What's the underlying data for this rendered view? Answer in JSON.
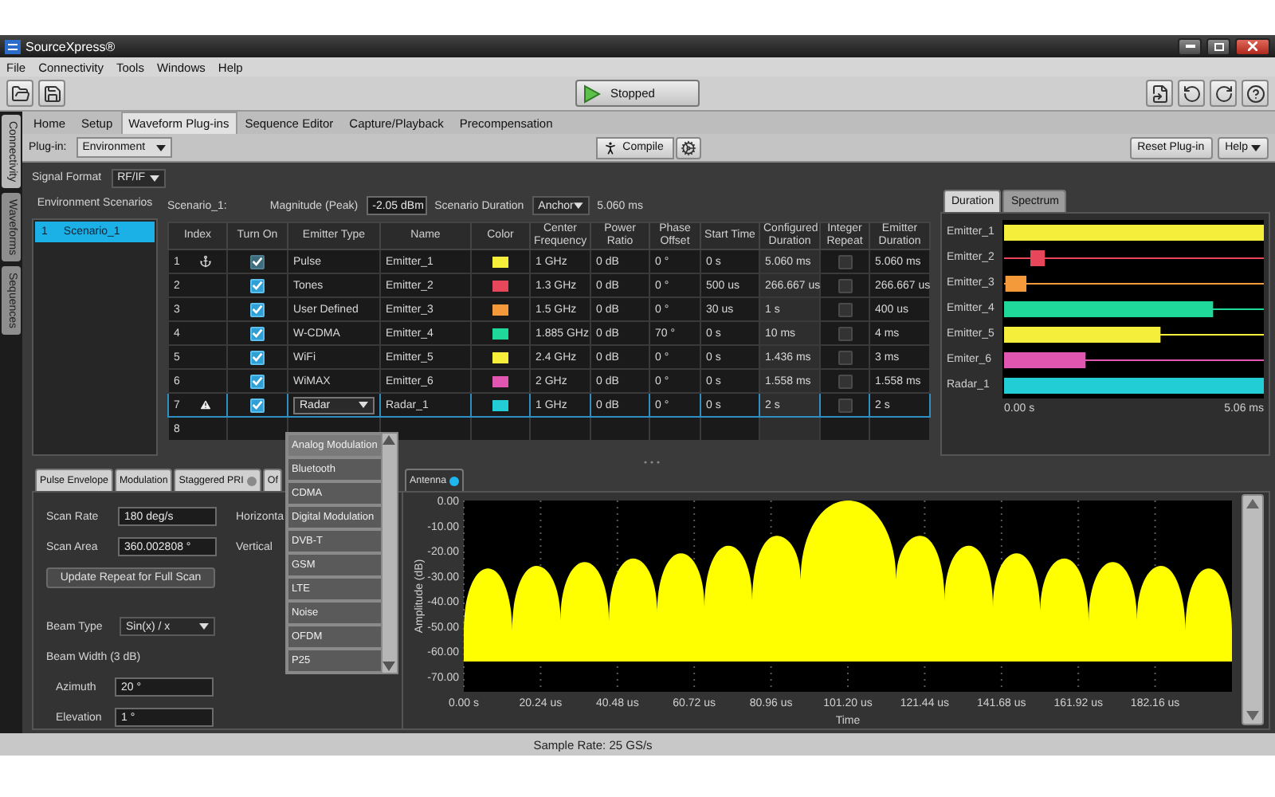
{
  "window": {
    "title": "SourceXpress®"
  },
  "menu": [
    "File",
    "Connectivity",
    "Tools",
    "Windows",
    "Help"
  ],
  "toolbar": {
    "run_button": "Stopped"
  },
  "side_tabs": [
    {
      "label": "Connectivity",
      "selected": true
    },
    {
      "label": "Waveforms",
      "selected": false
    },
    {
      "label": "Sequences",
      "selected": false
    }
  ],
  "tabs": [
    {
      "label": "Home",
      "selected": false
    },
    {
      "label": "Setup",
      "selected": false
    },
    {
      "label": "Waveform Plug-ins",
      "selected": true
    },
    {
      "label": "Sequence Editor",
      "selected": false
    },
    {
      "label": "Capture/Playback",
      "selected": false
    },
    {
      "label": "Precompensation",
      "selected": false
    }
  ],
  "plugin_bar": {
    "label": "Plug-in:",
    "plugin": "Environment",
    "compile": "Compile",
    "reset": "Reset Plug-in",
    "help": "Help"
  },
  "signal_format": {
    "label": "Signal Format",
    "value": "RF/IF"
  },
  "scenarios": {
    "title": "Environment Scenarios",
    "items": [
      {
        "index": "1",
        "name": "Scenario_1",
        "selected": true
      }
    ]
  },
  "scenario": {
    "name": "Scenario_1:",
    "magnitude_label": "Magnitude (Peak)",
    "magnitude": "-2.05 dBm",
    "duration_label": "Scenario Duration",
    "duration_mode": "Anchor",
    "duration": "5.060 ms"
  },
  "table": {
    "columns": [
      "Index",
      "Turn On",
      "Emitter Type",
      "Name",
      "Color",
      "Center Frequency",
      "Power Ratio",
      "Phase Offset",
      "Start Time",
      "Configured Duration",
      "Integer Repeat",
      "Emitter Duration"
    ],
    "rows": [
      {
        "index": "1",
        "anchored": true,
        "warning": false,
        "turn_on": true,
        "disabled": true,
        "editing": false,
        "selected": false,
        "emitter_type": "Pulse",
        "name": "Emitter_1",
        "color": "#f5ee3b",
        "center_frequency": "1 GHz",
        "power_ratio": "0 dB",
        "phase_offset": "0 °",
        "start_time": "0 s",
        "configured_duration": "5.060 ms",
        "integer_repeat": false,
        "emitter_duration": "5.060 ms"
      },
      {
        "index": "2",
        "anchored": false,
        "warning": false,
        "turn_on": true,
        "disabled": false,
        "editing": false,
        "selected": false,
        "emitter_type": "Tones",
        "name": "Emitter_2",
        "color": "#e8465a",
        "center_frequency": "1.3 GHz",
        "power_ratio": "0 dB",
        "phase_offset": "0 °",
        "start_time": "500 us",
        "configured_duration": "266.667 us",
        "integer_repeat": false,
        "emitter_duration": "266.667 us"
      },
      {
        "index": "3",
        "anchored": false,
        "warning": false,
        "turn_on": true,
        "disabled": false,
        "editing": false,
        "selected": false,
        "emitter_type": "User Defined",
        "name": "Emitter_3",
        "color": "#f59a3a",
        "center_frequency": "1.5 GHz",
        "power_ratio": "0 dB",
        "phase_offset": "0 °",
        "start_time": "30 us",
        "configured_duration": "1 s",
        "integer_repeat": false,
        "emitter_duration": "400 us"
      },
      {
        "index": "4",
        "anchored": false,
        "warning": false,
        "turn_on": true,
        "disabled": false,
        "editing": false,
        "selected": false,
        "emitter_type": "W-CDMA",
        "name": "Emitter_4",
        "color": "#1fd99a",
        "center_frequency": "1.885 GHz",
        "power_ratio": "0 dB",
        "phase_offset": "70 °",
        "start_time": "0 s",
        "configured_duration": "10 ms",
        "integer_repeat": false,
        "emitter_duration": "4 ms"
      },
      {
        "index": "5",
        "anchored": false,
        "warning": false,
        "turn_on": true,
        "disabled": false,
        "editing": false,
        "selected": false,
        "emitter_type": "WiFi",
        "name": "Emitter_5",
        "color": "#f5ee3b",
        "center_frequency": "2.4 GHz",
        "power_ratio": "0 dB",
        "phase_offset": "0 °",
        "start_time": "0 s",
        "configured_duration": "1.436 ms",
        "integer_repeat": false,
        "emitter_duration": "3 ms"
      },
      {
        "index": "6",
        "anchored": false,
        "warning": false,
        "turn_on": true,
        "disabled": false,
        "editing": false,
        "selected": false,
        "emitter_type": "WiMAX",
        "name": "Emitter_6",
        "color": "#e056b0",
        "center_frequency": "2 GHz",
        "power_ratio": "0 dB",
        "phase_offset": "0 °",
        "start_time": "0 s",
        "configured_duration": "1.558 ms",
        "integer_repeat": false,
        "emitter_duration": "1.558 ms"
      },
      {
        "index": "7",
        "anchored": false,
        "warning": true,
        "turn_on": true,
        "disabled": false,
        "editing": true,
        "selected": true,
        "emitter_type": "Radar",
        "name": "Radar_1",
        "color": "#22cdd6",
        "center_frequency": "1 GHz",
        "power_ratio": "0 dB",
        "phase_offset": "0 °",
        "start_time": "0 s",
        "configured_duration": "2 s",
        "integer_repeat": false,
        "emitter_duration": "2 s"
      },
      {
        "index": "8",
        "selected": false
      }
    ]
  },
  "emitter_type_dropdown": {
    "items": [
      {
        "label": "Analog Modulation",
        "selected": true
      },
      {
        "label": "Bluetooth",
        "selected": false
      },
      {
        "label": "CDMA",
        "selected": false
      },
      {
        "label": "Digital Modulation",
        "selected": false
      },
      {
        "label": "DVB-T",
        "selected": false
      },
      {
        "label": "GSM",
        "selected": false
      },
      {
        "label": "LTE",
        "selected": false
      },
      {
        "label": "Noise",
        "selected": false
      },
      {
        "label": "OFDM",
        "selected": false
      },
      {
        "label": "P25",
        "selected": false
      }
    ]
  },
  "duration_panel": {
    "tabs": [
      {
        "label": "Duration",
        "selected": true
      },
      {
        "label": "Spectrum",
        "selected": false
      }
    ],
    "rows": [
      {
        "label": "Emitter_1",
        "color": "#f5ee3b"
      },
      {
        "label": "Emitter_2",
        "color": "#e8465a"
      },
      {
        "label": "Emitter_3",
        "color": "#f59a3a"
      },
      {
        "label": "Emitter_4",
        "color": "#1fd99a"
      },
      {
        "label": "Emitter_5",
        "color": "#f5ee3b"
      },
      {
        "label": "Emiter_6",
        "color": "#e056b0"
      },
      {
        "label": "Radar_1",
        "color": "#22cdd6"
      }
    ],
    "axis_start": "0.00 s",
    "axis_end": "5.06 ms"
  },
  "lower_tabs": [
    {
      "label": "Pulse Envelope",
      "selected": false
    },
    {
      "label": "Modulation",
      "selected": false
    },
    {
      "label": "Staggered PRI",
      "selected": false,
      "indicator_on": false
    },
    {
      "label": "Of",
      "selected": false
    },
    {
      "label": "Antenna",
      "selected": true,
      "indicator_on": true
    }
  ],
  "antenna": {
    "fields": [
      {
        "label": "Scan Rate",
        "value": "180 deg/s",
        "side_label": "Horizonta"
      },
      {
        "label": "Scan Area",
        "value": "360.002808 °",
        "side_label": "Vertical"
      }
    ],
    "update_button": "Update Repeat for Full Scan",
    "beam_type": {
      "label": "Beam Type",
      "value": "Sin(x) / x"
    },
    "beam_width": {
      "label": "Beam Width (3 dB)",
      "fields": [
        {
          "label": "Azimuth",
          "value": "20 °"
        },
        {
          "label": "Elevation",
          "value": "1 °"
        }
      ]
    }
  },
  "plot": {
    "chart_data": {
      "type": "area",
      "grid": true,
      "xlabel": "Time",
      "ylabel": "Amplitude (dB)",
      "xlim": [
        0,
        202.4
      ],
      "ylim": [
        -76,
        0
      ],
      "x": [
        0,
        0,
        6.37,
        12.74,
        19.12,
        25.49,
        31.86,
        38.23,
        44.6,
        50.97,
        57.2,
        63.42,
        69.7,
        76.01,
        82.4,
        88.76,
        101.2,
        113.94,
        120.3,
        126.69,
        133.06,
        139.43,
        145.65,
        151.87,
        158.25,
        164.62,
        170.99,
        177.36,
        183.73,
        190.11,
        196.25,
        202.4,
        202.4
      ],
      "series": [
        {
          "color": "#ffff00",
          "values": [
            -64,
            -52,
            -27,
            -52,
            -26,
            -47.6,
            -24.5,
            -48,
            -23,
            -44.6,
            -21,
            -42.5,
            -18,
            -40,
            -14,
            -31.5,
            0,
            -31.5,
            -14,
            -40,
            -18,
            -42.5,
            -21,
            -44.6,
            -23,
            -48,
            -24.5,
            -47.6,
            -26,
            -52,
            -27,
            -52,
            -64
          ]
        }
      ],
      "xticks": [
        {
          "value": 0,
          "label": "0.00 s"
        },
        {
          "value": 20.24,
          "label": "20.24 us"
        },
        {
          "value": 40.48,
          "label": "40.48 us"
        },
        {
          "value": 60.72,
          "label": "60.72 us"
        },
        {
          "value": 80.96,
          "label": "80.96 us"
        },
        {
          "value": 101.2,
          "label": "101.20 us"
        },
        {
          "value": 121.44,
          "label": "121.44 us"
        },
        {
          "value": 141.68,
          "label": "141.68 us"
        },
        {
          "value": 161.92,
          "label": "161.92 us"
        },
        {
          "value": 182.16,
          "label": "182.16 us"
        }
      ],
      "yticks": [
        {
          "value": 0,
          "label": "0.00"
        },
        {
          "value": -10,
          "label": "-10.00"
        },
        {
          "value": -20,
          "label": "-20.00"
        },
        {
          "value": -30,
          "label": "-30.00"
        },
        {
          "value": -40,
          "label": "-40.00"
        },
        {
          "value": -50,
          "label": "-50.00"
        },
        {
          "value": -60,
          "label": "-60.00"
        },
        {
          "value": -70,
          "label": "-70.00"
        }
      ]
    }
  },
  "status_bar": {
    "text": "Sample Rate: 25 GS/s"
  }
}
